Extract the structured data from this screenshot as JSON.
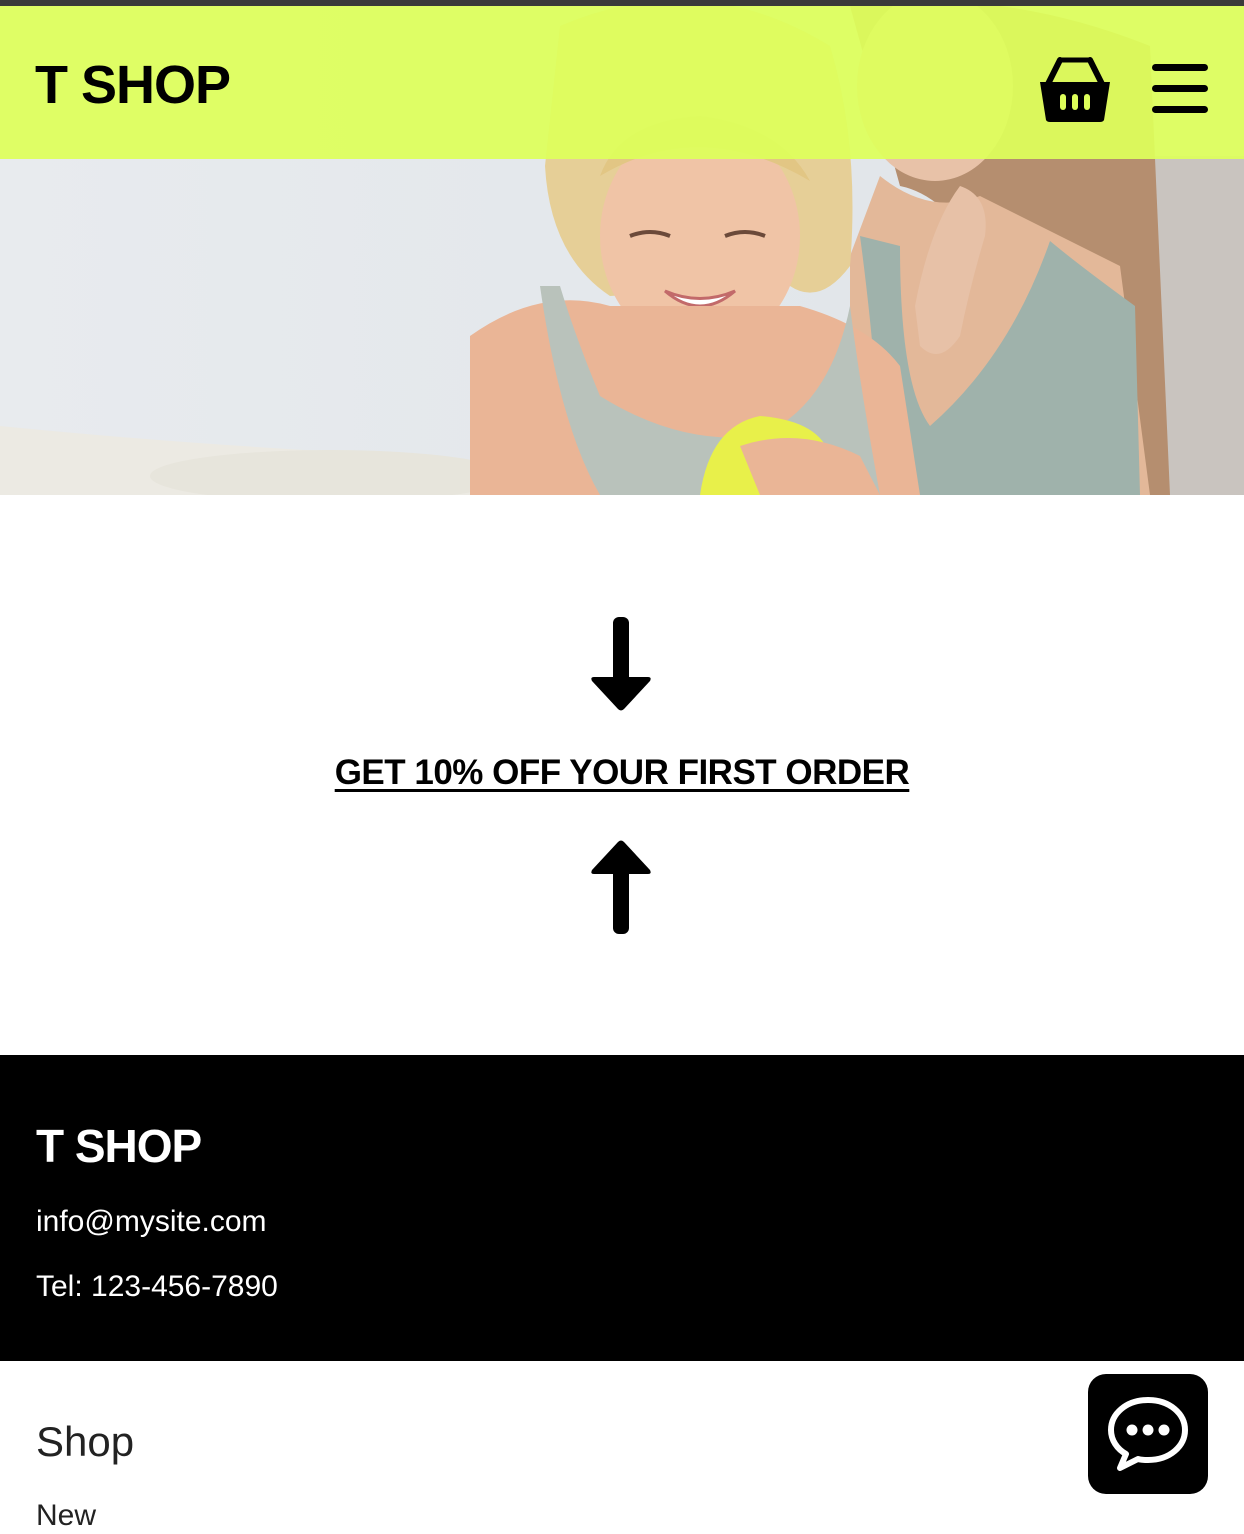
{
  "header": {
    "logo": "T SHOP",
    "cart_icon": "basket-icon",
    "menu_icon": "hamburger-menu-icon"
  },
  "hero": {
    "image": "two-women-smiling-photo"
  },
  "promo": {
    "link_text": "GET 10% OFF YOUR FIRST ORDER",
    "top_icon": "arrow-down-icon",
    "bottom_icon": "arrow-up-icon"
  },
  "footer": {
    "logo": "T SHOP",
    "email": "info@mysite.com",
    "tel": "Tel: 123-456-7890"
  },
  "bottom": {
    "shop_heading": "Shop",
    "new_link": "New",
    "chat_icon": "chat-bubble-icon"
  },
  "colors": {
    "accent": "#DEFF5A",
    "footer_bg": "#000000",
    "text": "#000000"
  }
}
